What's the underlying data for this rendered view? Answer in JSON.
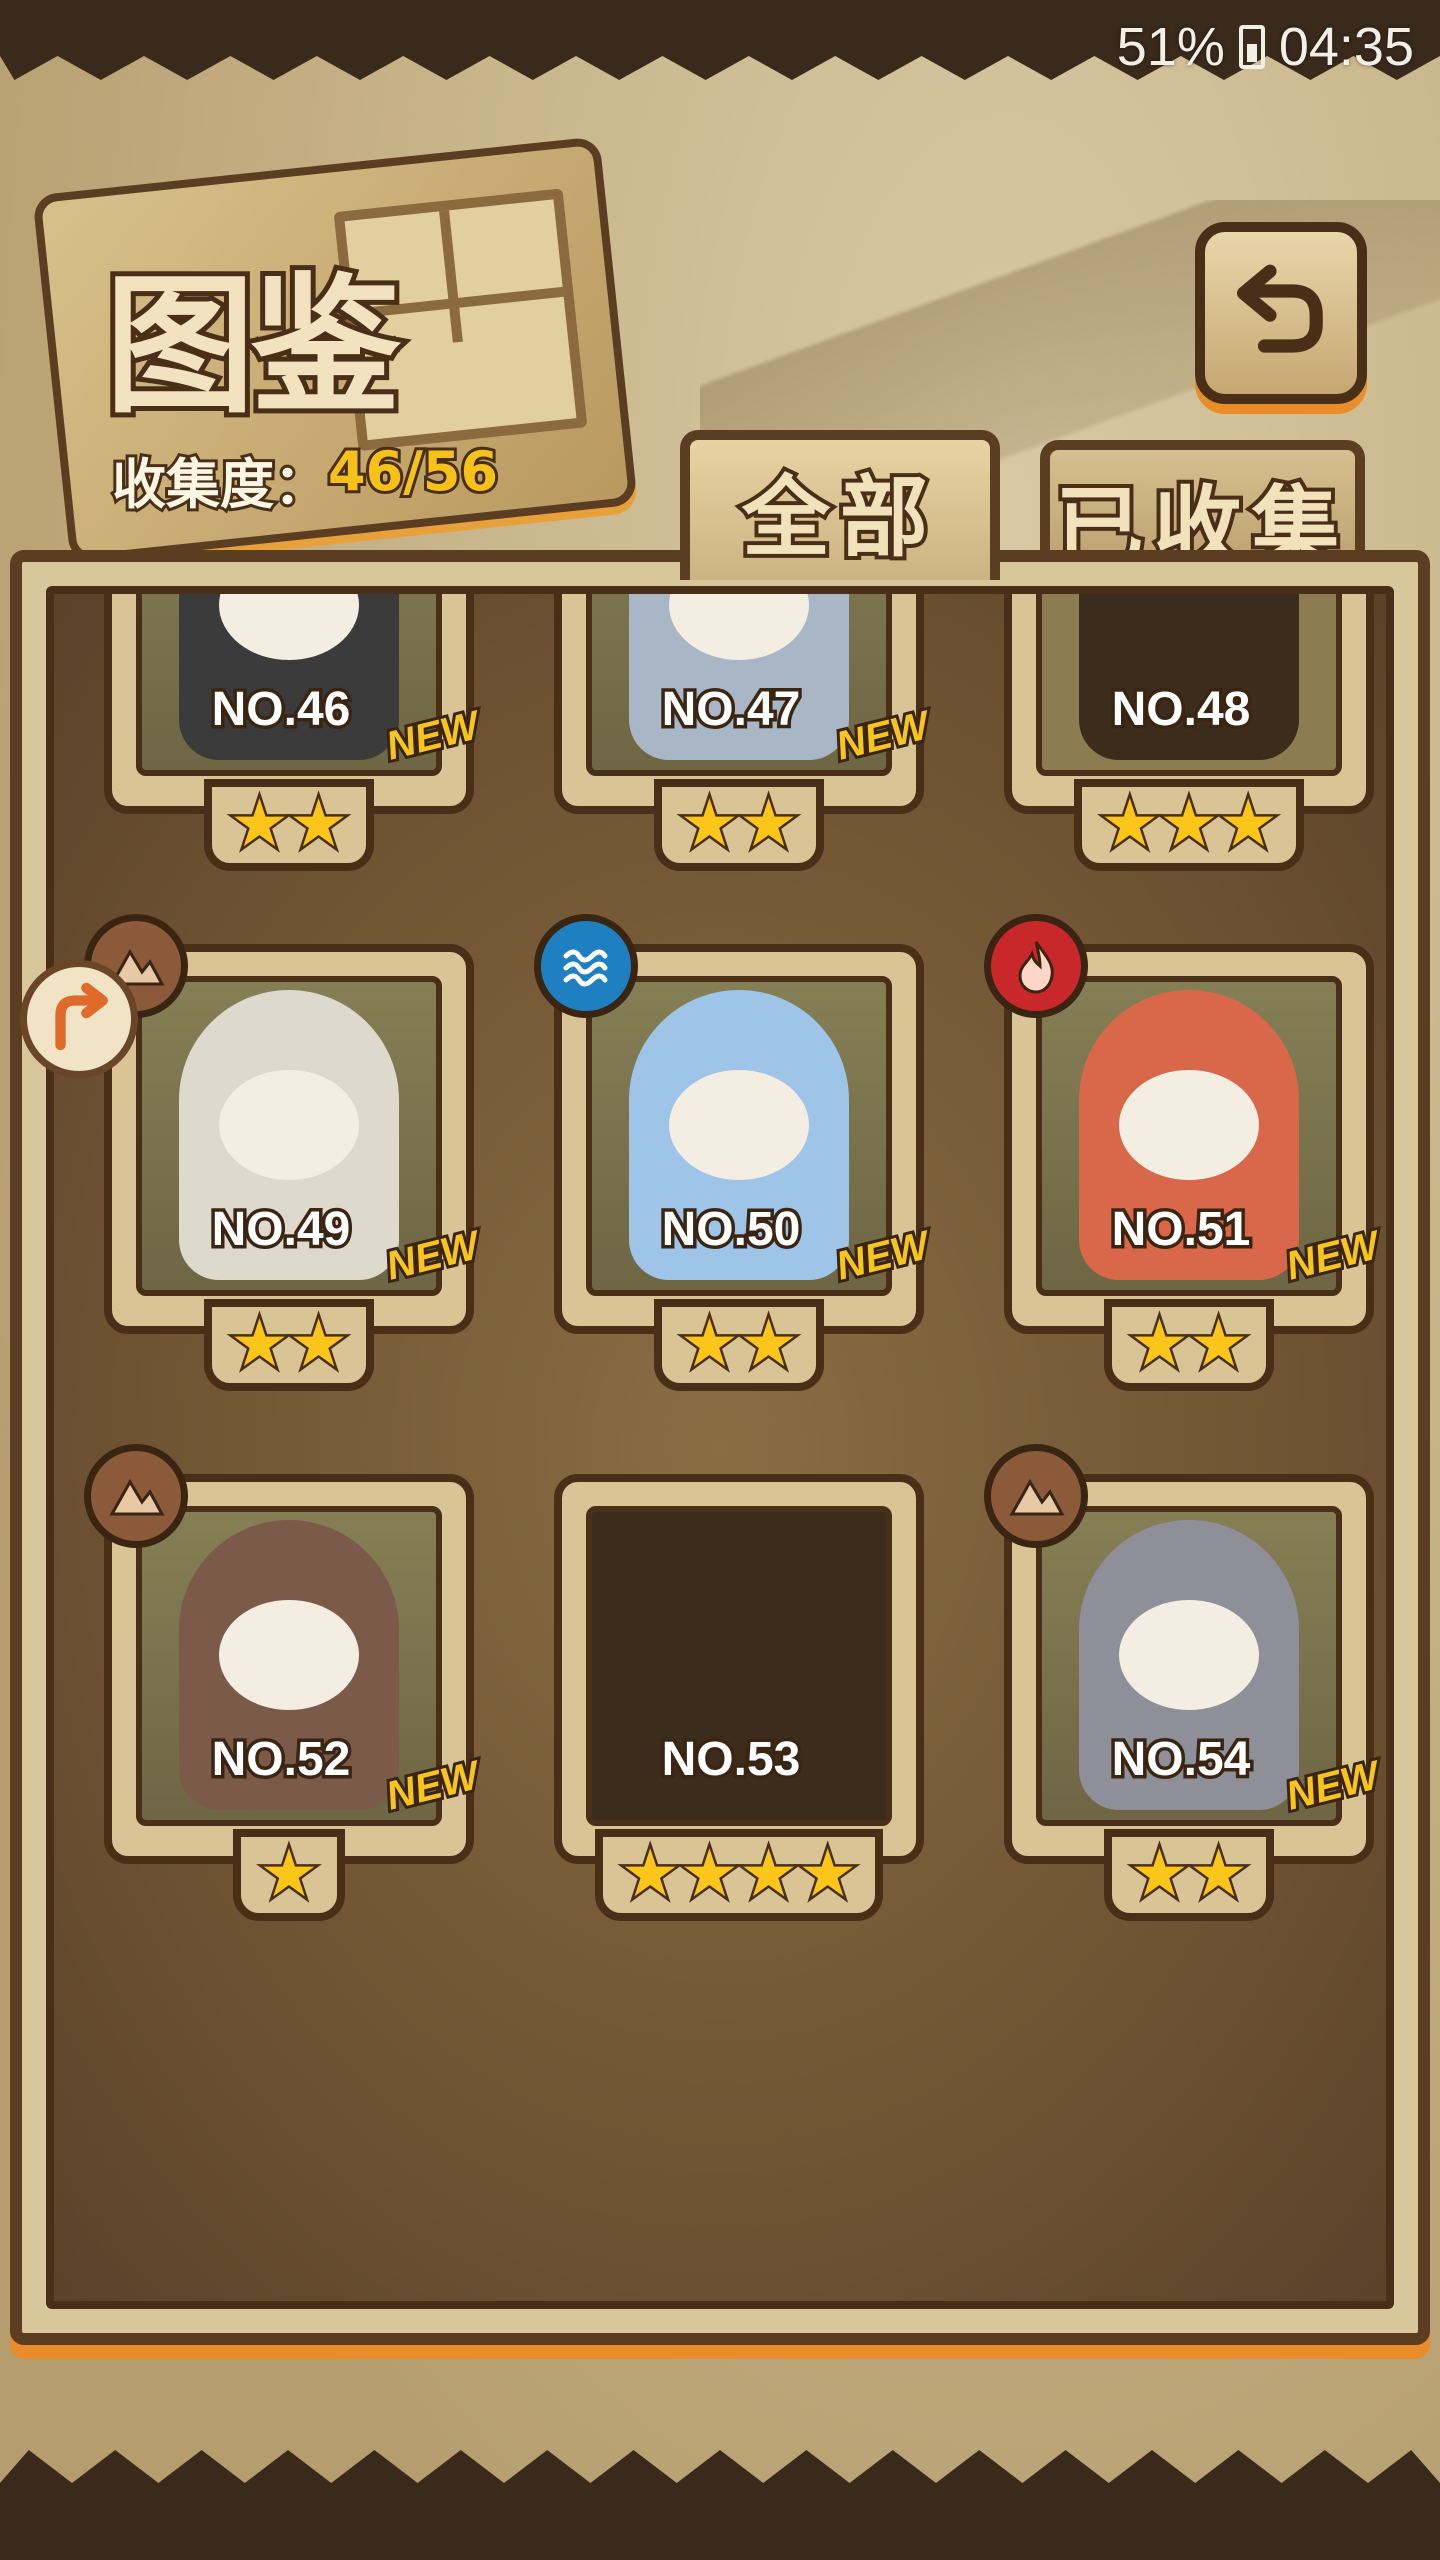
{
  "status_bar": {
    "battery": "51%",
    "time": "04:35"
  },
  "header": {
    "title": "图鉴",
    "collection_label": "收集度：",
    "collection_value": "46/56"
  },
  "tabs": [
    {
      "label": "全部",
      "active": true
    },
    {
      "label": "已收集",
      "active": false
    }
  ],
  "icons": {
    "back": "back-arrow-icon",
    "side_arrow": "rotate-arrow-icon",
    "elements": {
      "earth": "mountain-icon",
      "water": "water-waves-icon",
      "fire": "flame-icon"
    }
  },
  "colors": {
    "accent_orange": "#e88d2a",
    "star_yellow": "#fbc51a",
    "new_yellow": "#f7c51c",
    "earth": "#8a5a3a",
    "water": "#1e80c0",
    "fire": "#c8282a"
  },
  "cards": [
    {
      "no": "NO.46",
      "stars": "★★",
      "new": "NEW",
      "element": "earth",
      "state": "owned"
    },
    {
      "no": "NO.47",
      "stars": "★★",
      "new": "NEW",
      "element": "water",
      "state": "owned"
    },
    {
      "no": "NO.48",
      "stars": "★★★",
      "new": "",
      "element": "",
      "state": "silhouette"
    },
    {
      "no": "NO.49",
      "stars": "★★",
      "new": "NEW",
      "element": "earth",
      "state": "owned"
    },
    {
      "no": "NO.50",
      "stars": "★★",
      "new": "NEW",
      "element": "water",
      "state": "owned"
    },
    {
      "no": "NO.51",
      "stars": "★★",
      "new": "NEW",
      "element": "fire",
      "state": "owned"
    },
    {
      "no": "NO.52",
      "stars": "★",
      "new": "NEW",
      "element": "earth",
      "state": "owned"
    },
    {
      "no": "NO.53",
      "stars": "★★★★",
      "new": "",
      "element": "",
      "state": "locked"
    },
    {
      "no": "NO.54",
      "stars": "★★",
      "new": "NEW",
      "element": "earth",
      "state": "owned"
    }
  ]
}
